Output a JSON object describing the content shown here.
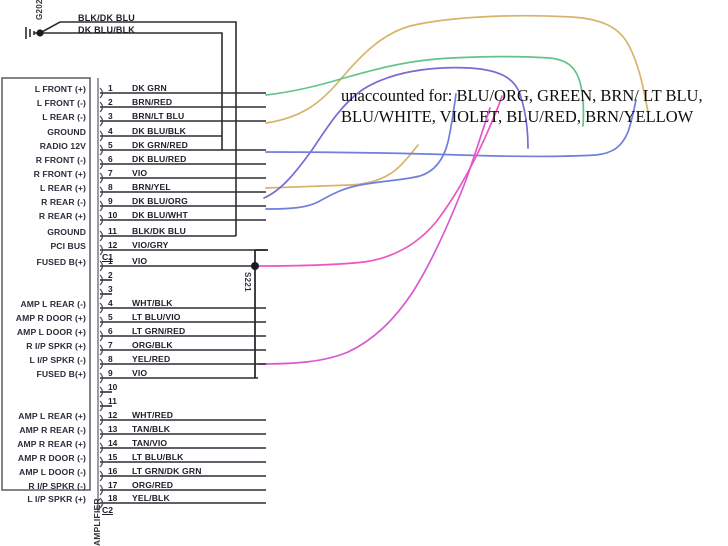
{
  "diagram": {
    "title_vertical_left": "AMPLIFIER",
    "ground_ref": "G202",
    "splice_ref": "S221",
    "top_wires": [
      {
        "name": "BLK/DK BLU"
      },
      {
        "name": "DK BLU/BLK"
      }
    ],
    "annotation": {
      "text": "unaccounted for: BLU/ORG, GREEN, BRN/ LT BLU, BLU/WHITE, VIOLET, BLU/RED, BRN/YELLOW"
    },
    "connectors": [
      {
        "id": "C1",
        "label": "C1",
        "pins": [
          {
            "num": "1",
            "func": "L FRONT (+)",
            "wire": "DK GRN"
          },
          {
            "num": "2",
            "func": "L FRONT (-)",
            "wire": "BRN/RED"
          },
          {
            "num": "3",
            "func": "L REAR (-)",
            "wire": "BRN/LT BLU"
          },
          {
            "num": "4",
            "func": "GROUND",
            "wire": "DK BLU/BLK"
          },
          {
            "num": "5",
            "func": "RADIO 12V",
            "wire": "DK GRN/RED"
          },
          {
            "num": "6",
            "func": "R FRONT (-)",
            "wire": "DK BLU/RED"
          },
          {
            "num": "7",
            "func": "R FRONT (+)",
            "wire": "VIO"
          },
          {
            "num": "8",
            "func": "L REAR (+)",
            "wire": "BRN/YEL"
          },
          {
            "num": "9",
            "func": "R REAR (-)",
            "wire": "DK BLU/ORG"
          },
          {
            "num": "10",
            "func": "R REAR (+)",
            "wire": "DK BLU/WHT"
          },
          {
            "num": "11",
            "func": "GROUND",
            "wire": "BLK/DK BLU"
          },
          {
            "num": "12",
            "func": "PCI BUS",
            "wire": "VIO/GRY"
          }
        ]
      },
      {
        "id": "C2",
        "label": "C2",
        "pins": [
          {
            "num": "1",
            "func": "FUSED B(+)",
            "wire": "VIO"
          },
          {
            "num": "2",
            "func": "",
            "wire": ""
          },
          {
            "num": "3",
            "func": "",
            "wire": ""
          },
          {
            "num": "4",
            "func": "AMP L REAR (-)",
            "wire": "WHT/BLK"
          },
          {
            "num": "5",
            "func": "AMP R DOOR (+)",
            "wire": "LT BLU/VIO"
          },
          {
            "num": "6",
            "func": "AMP L DOOR (+)",
            "wire": "LT GRN/RED"
          },
          {
            "num": "7",
            "func": "R I/P SPKR (+)",
            "wire": "ORG/BLK"
          },
          {
            "num": "8",
            "func": "L I/P SPKR (-)",
            "wire": "YEL/RED"
          },
          {
            "num": "9",
            "func": "FUSED B(+)",
            "wire": "VIO"
          },
          {
            "num": "10",
            "func": "",
            "wire": ""
          },
          {
            "num": "11",
            "func": "",
            "wire": ""
          },
          {
            "num": "12",
            "func": "AMP L REAR (+)",
            "wire": "WHT/RED"
          },
          {
            "num": "13",
            "func": "AMP R REAR (-)",
            "wire": "TAN/BLK"
          },
          {
            "num": "14",
            "func": "AMP R REAR (+)",
            "wire": "TAN/VIO"
          },
          {
            "num": "15",
            "func": "AMP R DOOR (-)",
            "wire": "LT BLU/BLK"
          },
          {
            "num": "16",
            "func": "AMP L DOOR (-)",
            "wire": "LT GRN/DK GRN"
          },
          {
            "num": "17",
            "func": "R I/P SPKR (-)",
            "wire": "ORG/RED"
          },
          {
            "num": "18",
            "func": "L I/P SPKR (+)",
            "wire": "YEL/BLK"
          }
        ]
      }
    ],
    "colors": {
      "wire_black": "#2b2b33",
      "wire_gray": "#6e6e78",
      "trace_tan": "#d6b469",
      "trace_green": "#62c48a",
      "trace_purple": "#7b6bd0",
      "trace_blue": "#6f7fdb",
      "trace_magenta": "#ee55c0",
      "trace_pink": "#d95ad0",
      "box_outline": "#5a5a64",
      "text": "#1e1e28"
    }
  }
}
